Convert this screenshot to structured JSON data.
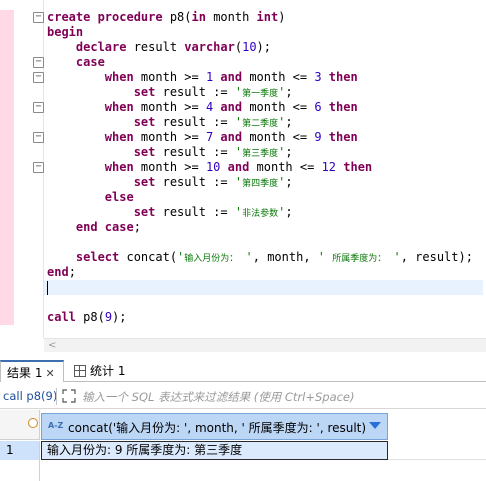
{
  "editor": {
    "lines": [
      [
        {
          "t": "create procedure ",
          "c": "kw"
        },
        {
          "t": "p8(",
          "c": ""
        },
        {
          "t": "in",
          "c": "kw"
        },
        {
          "t": " month ",
          "c": ""
        },
        {
          "t": "int",
          "c": "kw"
        },
        {
          "t": ")",
          "c": ""
        }
      ],
      [
        {
          "t": "begin",
          "c": "kw"
        }
      ],
      [
        {
          "t": "    declare",
          "c": "kw"
        },
        {
          "t": " result ",
          "c": ""
        },
        {
          "t": "varchar",
          "c": "kw"
        },
        {
          "t": "(",
          "c": ""
        },
        {
          "t": "10",
          "c": "num"
        },
        {
          "t": ");",
          "c": ""
        }
      ],
      [
        {
          "t": "    case",
          "c": "kw"
        }
      ],
      [
        {
          "t": "        when",
          "c": "kw"
        },
        {
          "t": " month >= ",
          "c": ""
        },
        {
          "t": "1",
          "c": "num"
        },
        {
          "t": " and",
          "c": "kw"
        },
        {
          "t": " month <= ",
          "c": ""
        },
        {
          "t": "3",
          "c": "num"
        },
        {
          "t": " then",
          "c": "kw"
        }
      ],
      [
        {
          "t": "            set",
          "c": "kw"
        },
        {
          "t": " result := ",
          "c": ""
        },
        {
          "t": "'",
          "c": "str"
        },
        {
          "t": "第一季度",
          "c": "cjk"
        },
        {
          "t": "'",
          "c": "str"
        },
        {
          "t": ";",
          "c": ""
        }
      ],
      [
        {
          "t": "        when",
          "c": "kw"
        },
        {
          "t": " month >= ",
          "c": ""
        },
        {
          "t": "4",
          "c": "num"
        },
        {
          "t": " and",
          "c": "kw"
        },
        {
          "t": " month <= ",
          "c": ""
        },
        {
          "t": "6",
          "c": "num"
        },
        {
          "t": " then",
          "c": "kw"
        }
      ],
      [
        {
          "t": "            set",
          "c": "kw"
        },
        {
          "t": " result := ",
          "c": ""
        },
        {
          "t": "'",
          "c": "str"
        },
        {
          "t": "第二季度",
          "c": "cjk"
        },
        {
          "t": "'",
          "c": "str"
        },
        {
          "t": ";",
          "c": ""
        }
      ],
      [
        {
          "t": "        when",
          "c": "kw"
        },
        {
          "t": " month >= ",
          "c": ""
        },
        {
          "t": "7",
          "c": "num"
        },
        {
          "t": " and",
          "c": "kw"
        },
        {
          "t": " month <= ",
          "c": ""
        },
        {
          "t": "9",
          "c": "num"
        },
        {
          "t": " then",
          "c": "kw"
        }
      ],
      [
        {
          "t": "            set",
          "c": "kw"
        },
        {
          "t": " result := ",
          "c": ""
        },
        {
          "t": "'",
          "c": "str"
        },
        {
          "t": "第三季度",
          "c": "cjk"
        },
        {
          "t": "'",
          "c": "str"
        },
        {
          "t": ";",
          "c": ""
        }
      ],
      [
        {
          "t": "        when",
          "c": "kw"
        },
        {
          "t": " month >= ",
          "c": ""
        },
        {
          "t": "10",
          "c": "num"
        },
        {
          "t": " and",
          "c": "kw"
        },
        {
          "t": " month <= ",
          "c": ""
        },
        {
          "t": "12",
          "c": "num"
        },
        {
          "t": " then",
          "c": "kw"
        }
      ],
      [
        {
          "t": "            set",
          "c": "kw"
        },
        {
          "t": " result := ",
          "c": ""
        },
        {
          "t": "'",
          "c": "str"
        },
        {
          "t": "第四季度",
          "c": "cjk"
        },
        {
          "t": "'",
          "c": "str"
        },
        {
          "t": ";",
          "c": ""
        }
      ],
      [
        {
          "t": "        else",
          "c": "kw"
        }
      ],
      [
        {
          "t": "            set",
          "c": "kw"
        },
        {
          "t": " result := ",
          "c": ""
        },
        {
          "t": "'",
          "c": "str"
        },
        {
          "t": "非法参数",
          "c": "cjk"
        },
        {
          "t": "'",
          "c": "str"
        },
        {
          "t": ";",
          "c": ""
        }
      ],
      [
        {
          "t": "    end case",
          "c": "kw"
        },
        {
          "t": ";",
          "c": ""
        }
      ],
      [],
      [
        {
          "t": "    select",
          "c": "kw"
        },
        {
          "t": " concat(",
          "c": ""
        },
        {
          "t": "'",
          "c": "str"
        },
        {
          "t": "输入月份为：",
          "c": "cjk"
        },
        {
          "t": " '",
          "c": "str"
        },
        {
          "t": ", month, ",
          "c": ""
        },
        {
          "t": "' ",
          "c": "str"
        },
        {
          "t": "所属季度为：",
          "c": "cjk"
        },
        {
          "t": " '",
          "c": "str"
        },
        {
          "t": ", result);",
          "c": ""
        }
      ],
      [
        {
          "t": "end",
          "c": "kw"
        },
        {
          "t": ";",
          "c": ""
        }
      ],
      [],
      [],
      [
        {
          "t": "call",
          "c": "kw"
        },
        {
          "t": " p8(",
          "c": ""
        },
        {
          "t": "9",
          "c": "num"
        },
        {
          "t": ");",
          "c": ""
        }
      ]
    ],
    "current_line": 18,
    "fold_lines": [
      0,
      3,
      4,
      6,
      8,
      10
    ],
    "marker_lines": [
      0,
      1,
      2,
      3,
      4,
      5,
      6,
      7,
      8,
      9,
      10,
      11,
      12,
      13,
      14,
      15,
      16,
      17,
      18,
      19,
      20
    ]
  },
  "tabs": {
    "result_label": "结果 1",
    "close_glyph": "✕",
    "stats_label": "统计 1"
  },
  "filter": {
    "query_label": "call p8(9)",
    "placeholder": "输入一个 SQL 表达式来过滤结果 (使用 Ctrl+Space)"
  },
  "grid": {
    "type_icon": "A-Z",
    "column_header": "concat('输入月份为: ', month, ' 所属季度为: ', result)",
    "rows": [
      {
        "number": "1",
        "value": "输入月份为: 9 所属季度为: 第三季度"
      }
    ]
  },
  "colors": {
    "keyword": "#7f0055",
    "number": "#2f00c4",
    "string": "#0a7a0a",
    "accent": "#3d6fb0",
    "selected_row": "#dceafd"
  }
}
